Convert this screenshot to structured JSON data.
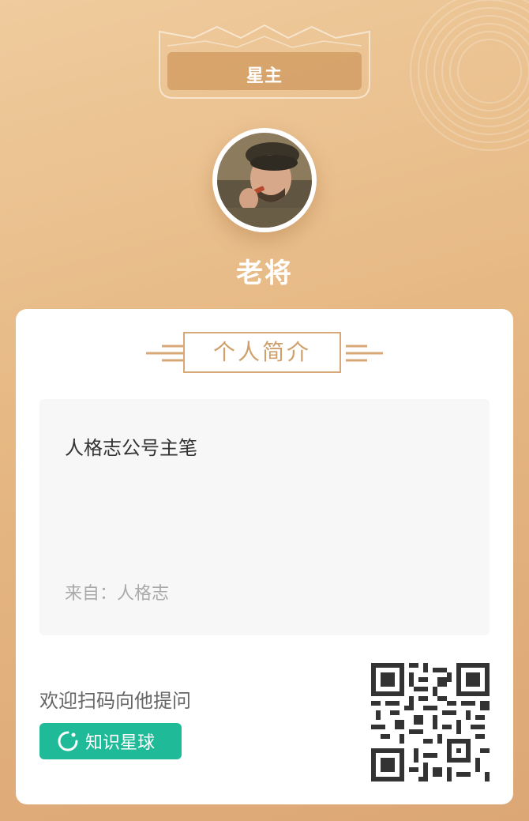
{
  "badge": {
    "label": "星主",
    "icon": "crown-frame-icon"
  },
  "profile": {
    "name": "老将",
    "avatar_icon": "avatar-portrait"
  },
  "intro": {
    "section_title": "个人简介",
    "bio": "人格志公号主笔",
    "from_label": "来自：",
    "from_value": "人格志"
  },
  "footer": {
    "invite_text": "欢迎扫码向他提问",
    "button_label": "知识星球",
    "button_icon": "zsxq-logo-icon",
    "qr_icon": "qr-code"
  },
  "colors": {
    "background_top": "#efcb9d",
    "background_bottom": "#dca775",
    "accent_gold": "#d7a977",
    "button_green": "#1fba98"
  }
}
